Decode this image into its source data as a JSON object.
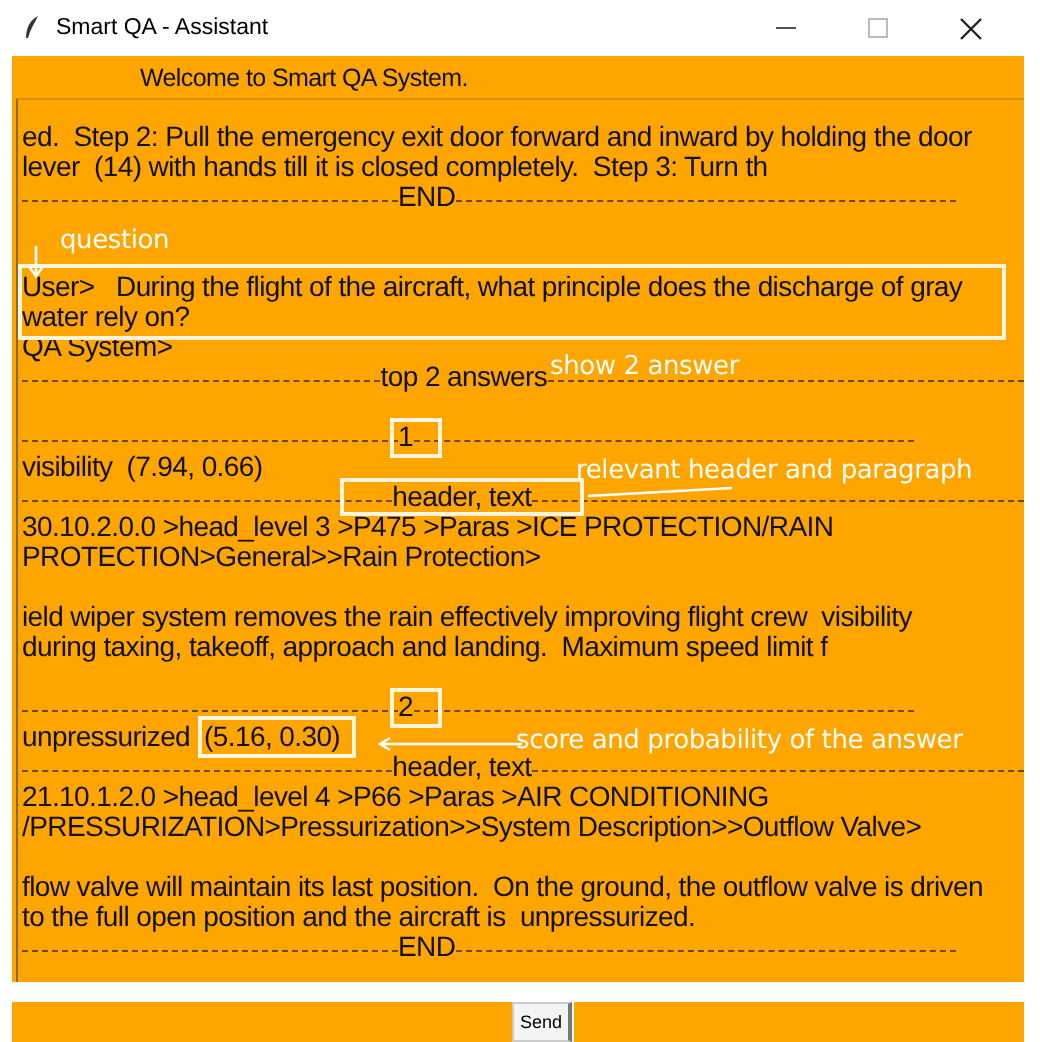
{
  "window": {
    "title": "Smart QA - Assistant"
  },
  "welcome": "Welcome to Smart QA System.",
  "transcript": [
    {
      "kind": "text",
      "text": "ed.  Step 2: Pull the emergency exit door forward and inward by holding the door"
    },
    {
      "kind": "text",
      "text": "lever  (14) with hands till it is closed completely.  Step 3: Turn th"
    },
    {
      "kind": "rule",
      "text": "END"
    },
    {
      "kind": "blank"
    },
    {
      "kind": "blank"
    },
    {
      "kind": "text",
      "text": "User>   During the flight of the aircraft, what principle does the discharge of gray"
    },
    {
      "kind": "text",
      "text": "water rely on?"
    },
    {
      "kind": "text",
      "text": "QA System>"
    },
    {
      "kind": "rule",
      "text": "top 2 answers"
    },
    {
      "kind": "blank"
    },
    {
      "kind": "rule",
      "text": "1"
    },
    {
      "kind": "answer",
      "text": "visibility",
      "score": "(7.94, 0.66)",
      "highlighted": false
    },
    {
      "kind": "rule",
      "text": "header, text"
    },
    {
      "kind": "text",
      "text": "30.10.2.0.0 >head_level 3 >P475 >Paras >ICE PROTECTION/RAIN"
    },
    {
      "kind": "text",
      "text": "PROTECTION>General>>Rain Protection>"
    },
    {
      "kind": "blank"
    },
    {
      "kind": "text",
      "text": "ield wiper system removes the rain effectively improving flight crew  visibility"
    },
    {
      "kind": "text",
      "text": "during taxing, takeoff, approach and landing.  Maximum speed limit f"
    },
    {
      "kind": "blank"
    },
    {
      "kind": "rule",
      "text": "2"
    },
    {
      "kind": "answer",
      "text": "unpressurized",
      "score": "(5.16, 0.30)",
      "highlighted": true
    },
    {
      "kind": "rule",
      "text": "header, text"
    },
    {
      "kind": "text",
      "text": "21.10.1.2.0 >head_level 4 >P66 >Paras >AIR CONDITIONING"
    },
    {
      "kind": "text",
      "text": "/PRESSURIZATION>Pressurization>>System Description>>Outflow Valve>"
    },
    {
      "kind": "blank"
    },
    {
      "kind": "text",
      "text": "flow valve will maintain its last position.  On the ground, the outflow valve is driven"
    },
    {
      "kind": "text",
      "text": "to the full open position and the aircraft is  unpressurized."
    },
    {
      "kind": "rule",
      "text": "END"
    }
  ],
  "annotations": [
    {
      "label": "question"
    },
    {
      "label": "show 2 answer"
    },
    {
      "label": "relevant header and paragraph"
    },
    {
      "label": "score and probability of the answer"
    }
  ],
  "send_button": "Send"
}
